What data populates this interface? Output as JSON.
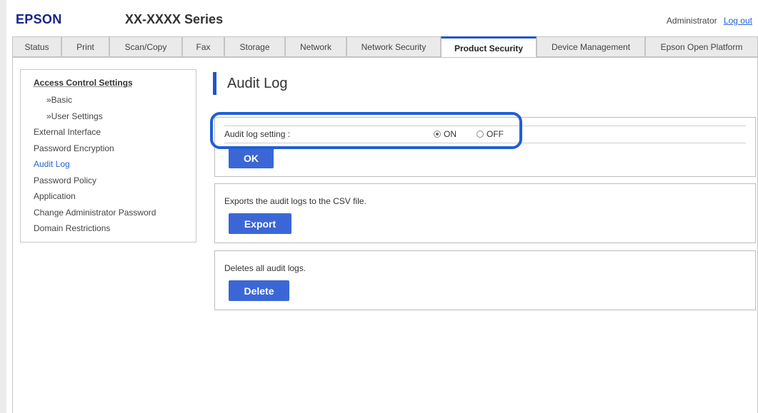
{
  "header": {
    "logo": "EPSON",
    "model": "XX-XXXX Series",
    "user": "Administrator",
    "logout": "Log out"
  },
  "tabs": [
    {
      "label": "Status"
    },
    {
      "label": "Print"
    },
    {
      "label": "Scan/Copy"
    },
    {
      "label": "Fax"
    },
    {
      "label": "Storage"
    },
    {
      "label": "Network"
    },
    {
      "label": "Network Security"
    },
    {
      "label": "Product Security",
      "active": true
    },
    {
      "label": "Device Management"
    },
    {
      "label": "Epson Open Platform"
    }
  ],
  "sidebar": {
    "title": "Access Control Settings",
    "items": [
      {
        "label": "»Basic"
      },
      {
        "label": "»User Settings"
      },
      {
        "label": "External Interface"
      },
      {
        "label": "Password Encryption"
      },
      {
        "label": "Audit Log",
        "active": true
      },
      {
        "label": "Password Policy"
      },
      {
        "label": "Application"
      },
      {
        "label": "Change Administrator Password"
      },
      {
        "label": "Domain Restrictions"
      }
    ]
  },
  "page": {
    "title": "Audit Log"
  },
  "audit_setting": {
    "label": "Audit log setting :",
    "on_label": "ON",
    "off_label": "OFF",
    "selected": "ON",
    "ok_button": "OK"
  },
  "export_section": {
    "description": "Exports the audit logs to the CSV file.",
    "button": "Export"
  },
  "delete_section": {
    "description": "Deletes all audit logs.",
    "button": "Delete"
  },
  "colors": {
    "accent": "#2257c9",
    "button": "#3b67d6",
    "link": "#2563d8",
    "highlight": "#1f5fd6"
  }
}
